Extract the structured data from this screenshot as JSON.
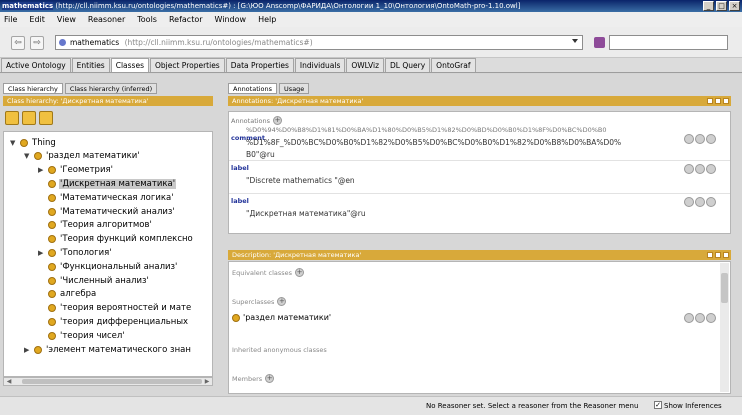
{
  "window": {
    "title_prefix": "mathematics",
    "title_rest": " (http://cll.niimm.ksu.ru/ontologies/mathematics#) : [G:\\ЮО Аnscomp\\ФАРИДА\\Онтологии 1_10\\Онтология\\OntoMath-pro-1.10.owl]",
    "buttons": [
      "_",
      "□",
      "×"
    ]
  },
  "menu": [
    "File",
    "Edit",
    "View",
    "Reasoner",
    "Tools",
    "Refactor",
    "Window",
    "Help"
  ],
  "nav": {
    "back_glyph": "⇦",
    "forward_glyph": "⇨",
    "ontology_name": "mathematics",
    "ontology_url": "(http://cll.niimm.ksu.ru/ontologies/mathematics#)"
  },
  "tabs": [
    {
      "label": "Active Ontology",
      "active": false
    },
    {
      "label": "Entities",
      "active": false
    },
    {
      "label": "Classes",
      "active": true
    },
    {
      "label": "Object Properties",
      "active": false
    },
    {
      "label": "Data Properties",
      "active": false
    },
    {
      "label": "Individuals",
      "active": false
    },
    {
      "label": "OWLViz",
      "active": false
    },
    {
      "label": "DL Query",
      "active": false
    },
    {
      "label": "OntoGraf",
      "active": false
    }
  ],
  "left": {
    "subtabs": [
      {
        "label": "Class hierarchy",
        "active": true
      },
      {
        "label": "Class hierarchy (inferred)",
        "active": false
      }
    ],
    "bar_title": "Class hierarchy: 'Дискретная математика'",
    "tree": [
      {
        "label": "Thing",
        "indent": 0,
        "toggle": "▼",
        "selected": false
      },
      {
        "label": "'раздел математики'",
        "indent": 1,
        "toggle": "▼",
        "selected": false
      },
      {
        "label": "'Геометрия'",
        "indent": 2,
        "toggle": "▶",
        "selected": false
      },
      {
        "label": "'Дискретная математика'",
        "indent": 2,
        "toggle": "",
        "selected": true
      },
      {
        "label": "'Математическая логика'",
        "indent": 2,
        "toggle": "",
        "selected": false
      },
      {
        "label": "'Математический анализ'",
        "indent": 2,
        "toggle": "",
        "selected": false
      },
      {
        "label": "'Теория алгоритмов'",
        "indent": 2,
        "toggle": "",
        "selected": false
      },
      {
        "label": "'Теория функций комплексно",
        "indent": 2,
        "toggle": "",
        "selected": false
      },
      {
        "label": "'Топология'",
        "indent": 2,
        "toggle": "▶",
        "selected": false
      },
      {
        "label": "'Функциональный анализ'",
        "indent": 2,
        "toggle": "",
        "selected": false
      },
      {
        "label": "'Численный анализ'",
        "indent": 2,
        "toggle": "",
        "selected": false
      },
      {
        "label": "алгебра",
        "indent": 2,
        "toggle": "",
        "selected": false
      },
      {
        "label": "'теория вероятностей и мате",
        "indent": 2,
        "toggle": "",
        "selected": false
      },
      {
        "label": "'теория дифференциальных",
        "indent": 2,
        "toggle": "",
        "selected": false
      },
      {
        "label": "'теория чисел'",
        "indent": 2,
        "toggle": "",
        "selected": false
      },
      {
        "label": "'элемент математического знан",
        "indent": 1,
        "toggle": "▶",
        "selected": false
      }
    ]
  },
  "annotations": {
    "subtabs": [
      {
        "label": "Annotations",
        "active": true
      },
      {
        "label": "Usage",
        "active": false
      }
    ],
    "bar_title": "Annotations: 'Дискретная математика'",
    "header": "Annotations",
    "items": [
      {
        "key": "comment",
        "value_lines": [
          "%D1%8F_%D0%BC%D0%B0%D1%82%D0%B5%D0%BC%D0%B0%D1%82%D0%B8%D0%BA%D0%",
          "B0\"@ru"
        ],
        "overflow_line": "%D0%94%D0%B8%D1%81%D0%BA%D1%80%D0%B5%D1%82%D0%BD%D0%B0%D1%8F%D0%BC%D0%B0"
      },
      {
        "key": "label",
        "value_lines": [
          "\"Discrete mathematics \"@en"
        ]
      },
      {
        "key": "label",
        "value_lines": [
          "\"Дискретная математика\"@ru"
        ]
      }
    ]
  },
  "description": {
    "bar_title": "Description: 'Дискретная математика'",
    "sections": [
      {
        "label": "Equivalent classes"
      },
      {
        "label": "Superclasses"
      },
      {
        "label": "Inherited anonymous classes"
      },
      {
        "label": "Members"
      }
    ],
    "superclass": "'раздел математики'"
  },
  "status": {
    "text": "No Reasoner set. Select a reasoner from the Reasoner menu",
    "check_label": "Show Inferences",
    "check_mark": "✓"
  }
}
